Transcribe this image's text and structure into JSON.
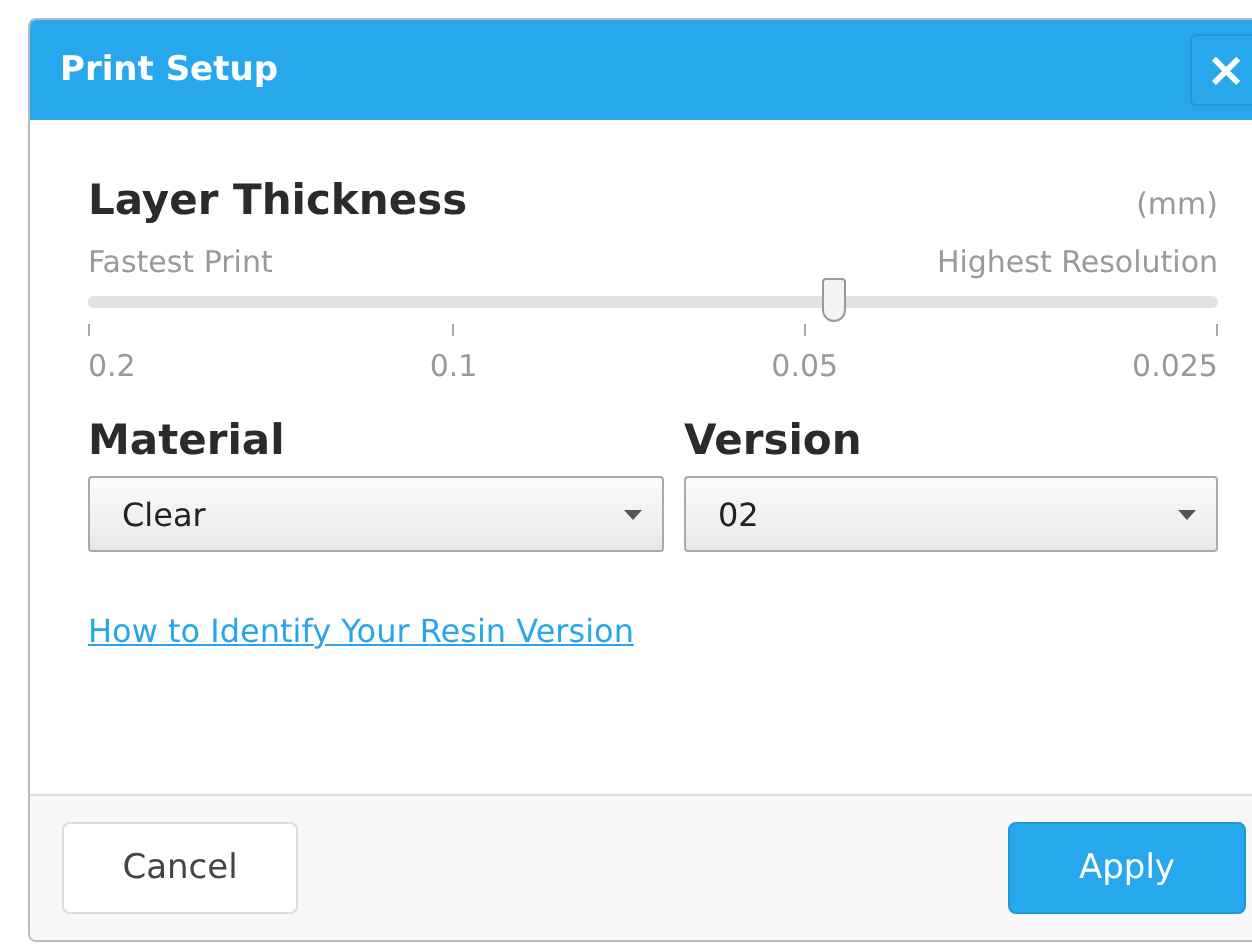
{
  "window": {
    "title": "Print Setup",
    "close": "×"
  },
  "layer_thickness": {
    "title": "Layer Thickness",
    "unit": "(mm)",
    "left_label": "Fastest Print",
    "right_label": "Highest Resolution",
    "level": 0.66,
    "ticks": [
      "0.2",
      "0.1",
      "0.05",
      "0.025"
    ]
  },
  "selects": [
    {
      "label": "Material",
      "value": "Clear"
    },
    {
      "label": "Version",
      "value": "02"
    }
  ],
  "link": "How to Identify Your Resin Version",
  "buttons": [
    {
      "label": "Cancel",
      "kind": "secondary"
    },
    {
      "label": "Apply",
      "kind": "primary"
    }
  ]
}
